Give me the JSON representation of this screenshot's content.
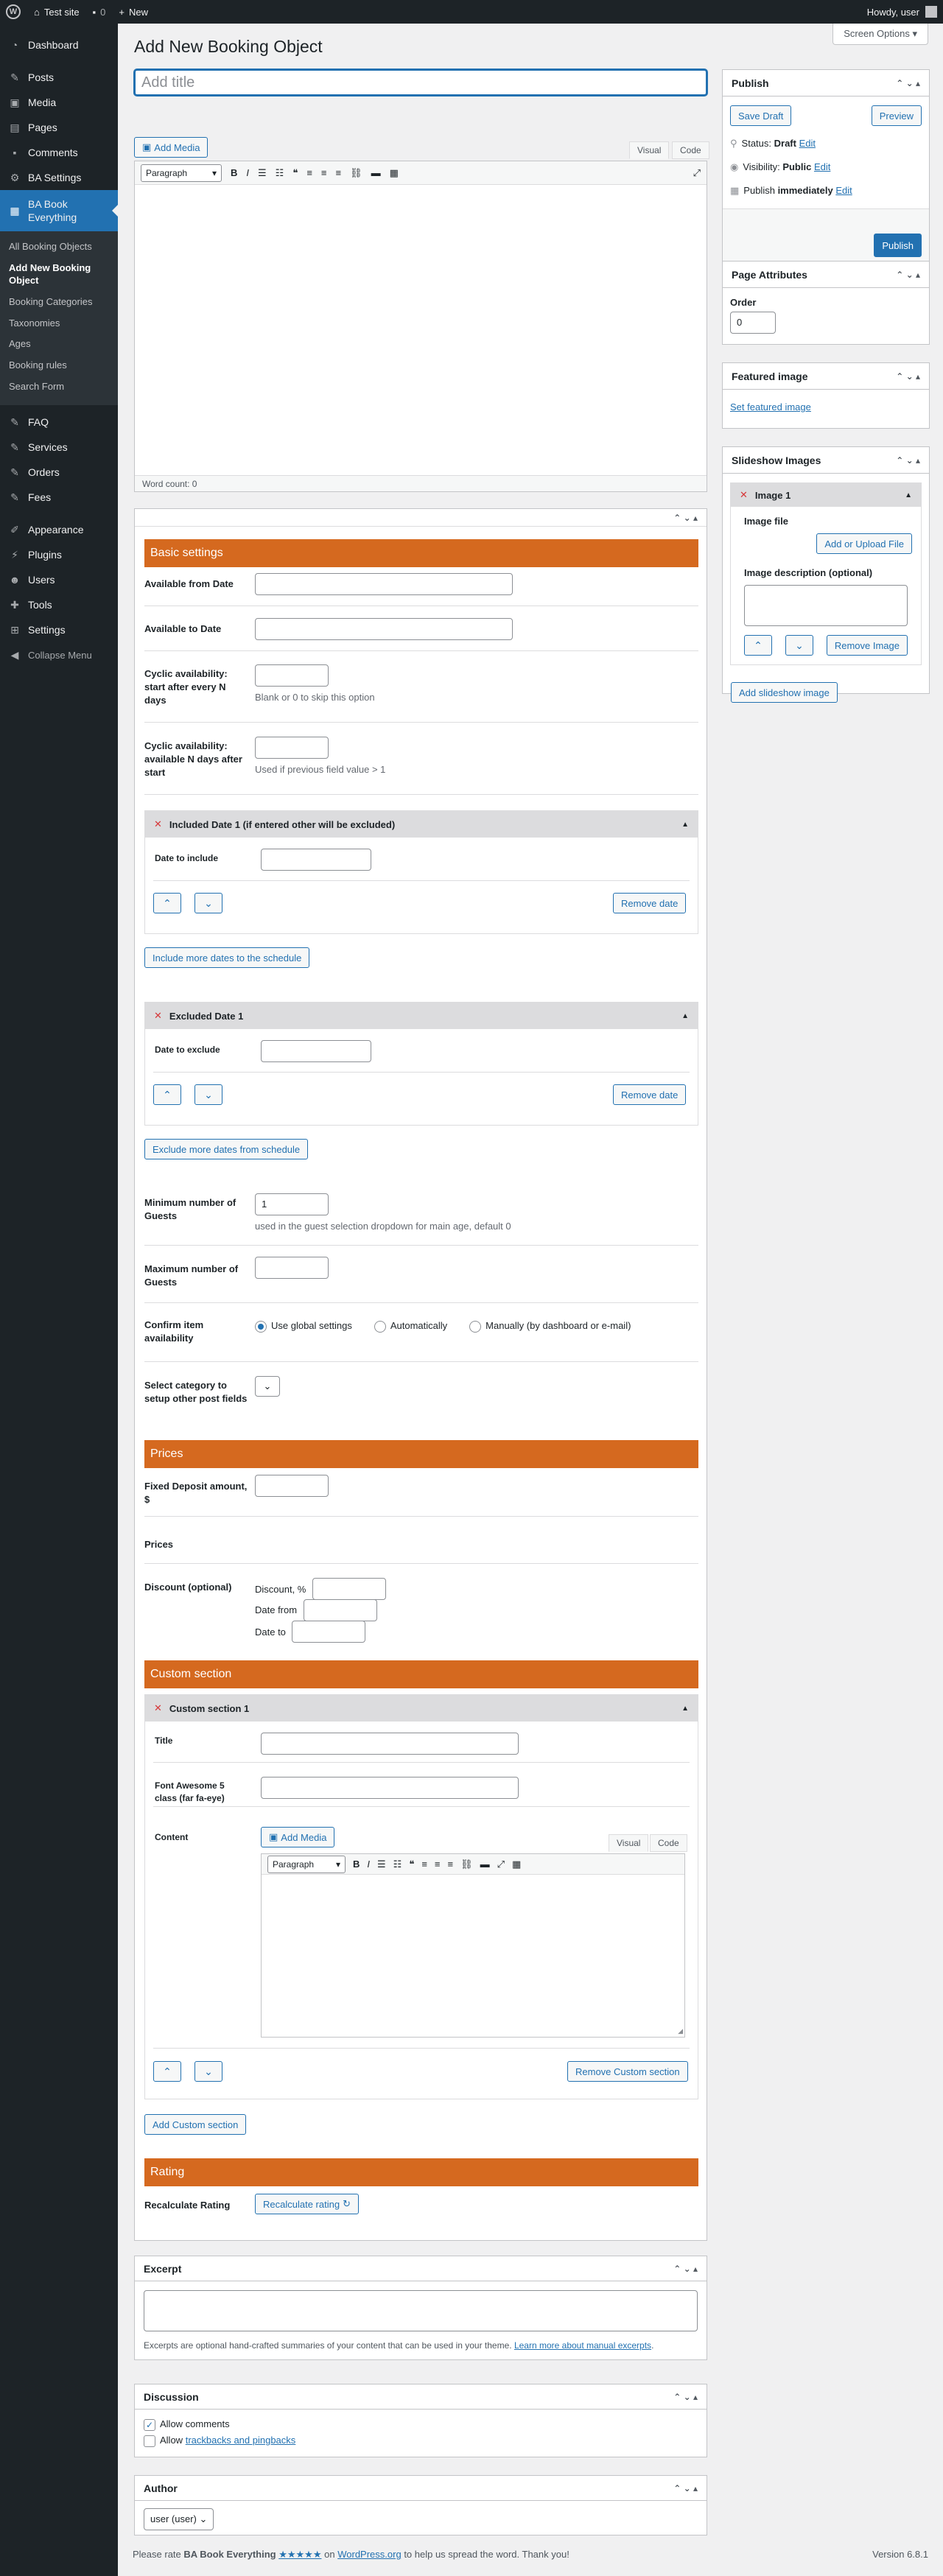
{
  "adminbar": {
    "site": "Test site",
    "comments": "0",
    "new": "New",
    "howdy": "Howdy, user"
  },
  "menu": {
    "dashboard": "Dashboard",
    "posts": "Posts",
    "media": "Media",
    "pages": "Pages",
    "comments": "Comments",
    "ba_settings": "BA Settings",
    "ba_book": "BA Book Everything",
    "sub": [
      "All Booking Objects",
      "Add New Booking Object",
      "Booking Categories",
      "Taxonomies",
      "Ages",
      "Booking rules",
      "Search Form"
    ],
    "faq": "FAQ",
    "services": "Services",
    "orders": "Orders",
    "fees": "Fees",
    "appearance": "Appearance",
    "plugins": "Plugins",
    "users": "Users",
    "tools": "Tools",
    "settings": "Settings",
    "collapse": "Collapse Menu"
  },
  "page": {
    "screen_options": "Screen Options",
    "heading": "Add New Booking Object",
    "title_placeholder": "Add title"
  },
  "editor": {
    "add_media": "Add Media",
    "visual": "Visual",
    "code": "Code",
    "paragraph": "Paragraph",
    "word_count": "Word count: 0"
  },
  "basic": {
    "header": "Basic settings",
    "available_from": "Available from Date",
    "available_to": "Available to Date",
    "cyclic_start": "Cyclic availability: start after every N days",
    "cyclic_start_hint": "Blank or 0 to skip this option",
    "cyclic_avail": "Cyclic availability: available N days after start",
    "cyclic_avail_hint": "Used if previous field value > 1",
    "included_header": "Included Date 1 (if entered other will be excluded)",
    "date_include": "Date to include",
    "remove_date": "Remove date",
    "include_more": "Include more dates to the schedule",
    "excluded_header": "Excluded Date 1",
    "date_exclude": "Date to exclude",
    "exclude_more": "Exclude more dates from schedule",
    "min_guests": "Minimum number of Guests",
    "min_guests_value": "1",
    "min_guests_hint": "used in the guest selection dropdown for main age, default 0",
    "max_guests": "Maximum number of Guests",
    "confirm": "Confirm item availability",
    "opt_global": "Use global settings",
    "opt_auto": "Automatically",
    "opt_manual": "Manually (by dashboard or e-mail)",
    "select_category": "Select category to setup other post fields"
  },
  "prices": {
    "header": "Prices",
    "deposit": "Fixed Deposit amount, $",
    "prices": "Prices",
    "discount": "Discount (optional)",
    "discount_pct": "Discount, %",
    "date_from": "Date from",
    "date_to": "Date to"
  },
  "custom": {
    "header": "Custom section",
    "section1": "Custom section 1",
    "title": "Title",
    "fa": "Font Awesome 5 class (far fa-eye)",
    "content": "Content",
    "remove": "Remove Custom section",
    "add": "Add Custom section"
  },
  "rating": {
    "header": "Rating",
    "recalc": "Recalculate Rating",
    "recalc_btn": "Recalculate rating"
  },
  "excerpt": {
    "header": "Excerpt",
    "hint": "Excerpts are optional hand-crafted summaries of your content that can be used in your theme.",
    "link": "Learn more about manual excerpts"
  },
  "discussion": {
    "header": "Discussion",
    "allow_comments": "Allow comments",
    "allow": "Allow",
    "trackbacks": "trackbacks and pingbacks"
  },
  "author": {
    "header": "Author",
    "value": "user (user)"
  },
  "publish": {
    "header": "Publish",
    "save_draft": "Save Draft",
    "preview": "Preview",
    "status_l": "Status:",
    "status_v": "Draft",
    "vis_l": "Visibility:",
    "vis_v": "Public",
    "pub_l": "Publish",
    "pub_v": "immediately",
    "edit": "Edit",
    "publish_btn": "Publish"
  },
  "attributes": {
    "header": "Page Attributes",
    "order_l": "Order",
    "order_v": "0"
  },
  "featured": {
    "header": "Featured image",
    "link": "Set featured image"
  },
  "slideshow": {
    "header": "Slideshow Images",
    "image1": "Image 1",
    "file": "Image file",
    "upload": "Add or Upload File",
    "desc": "Image description (optional)",
    "remove": "Remove Image",
    "add": "Add slideshow image"
  },
  "footer": {
    "text1": "Please rate",
    "plugin": "BA Book Everything",
    "stars": "★★★★★",
    "on": "on",
    "wporg": "WordPress.org",
    "text2": "to help us spread the word. Thank you!",
    "version": "Version 6.8.1"
  }
}
